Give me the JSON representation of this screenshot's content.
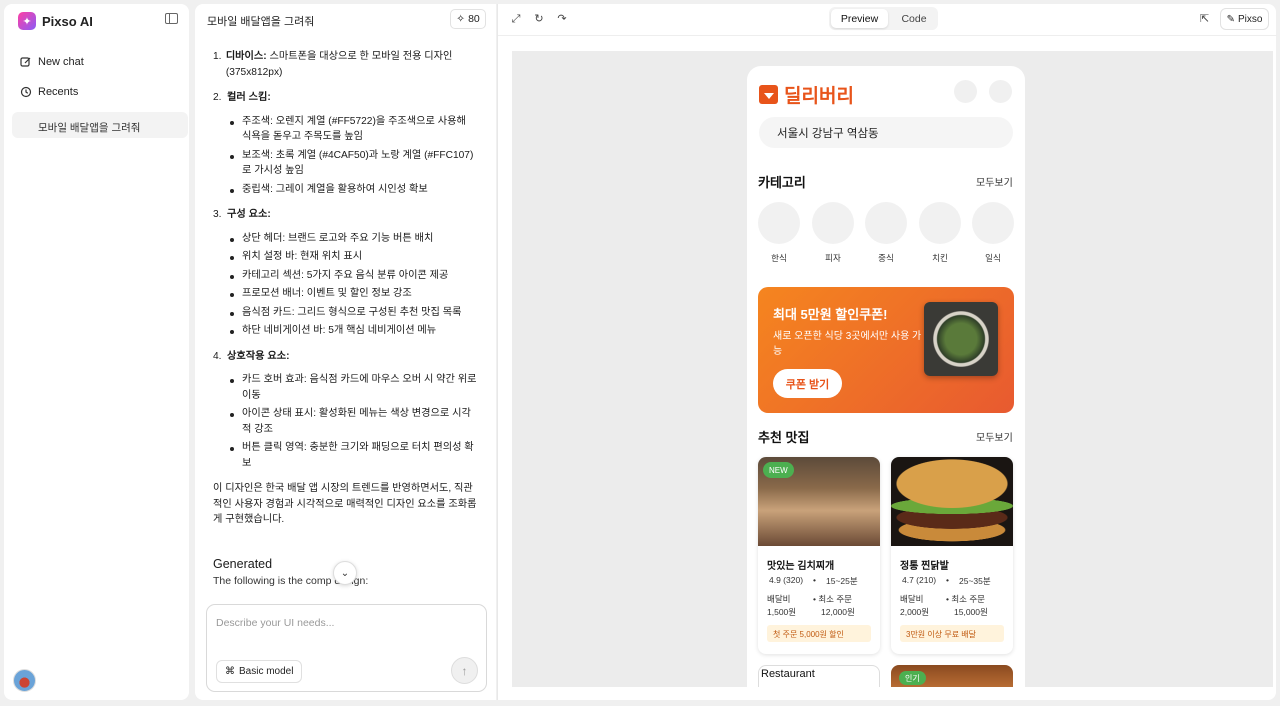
{
  "app": {
    "name": "Pixso AI"
  },
  "sidebar": {
    "new_chat": "New chat",
    "recents": "Recents",
    "recent_items": [
      "모바일 배달앱을 그려줘"
    ]
  },
  "chat": {
    "title": "모바일 배달앱을 그려줘",
    "credits": "80",
    "sections": [
      {
        "num": "1.",
        "title": "디바이스:",
        "text": " 스마트폰을 대상으로 한 모바일 전용 디자인 (375x812px)",
        "bullets": []
      },
      {
        "num": "2.",
        "title": "컬러 스킴:",
        "text": "",
        "bullets": [
          "주조색: 오렌지 계열 (#FF5722)을 주조색으로 사용해 식욕을 돋우고 주목도를 높임",
          "보조색: 초록 계열 (#4CAF50)과 노랑 계열 (#FFC107)로 가시성 높임",
          "중립색: 그레이 계열을 활용하여 시인성 확보"
        ]
      },
      {
        "num": "3.",
        "title": "구성 요소:",
        "text": "",
        "bullets": [
          "상단 헤더: 브랜드 로고와 주요 기능 버튼 배치",
          "위치 설정 바: 현재 위치 표시",
          "카테고리 섹션: 5가지 주요 음식 분류 아이콘 제공",
          "프로모션 배너: 이벤트 및 할인 정보 강조",
          "음식점 카드: 그리드 형식으로 구성된 추천 맛집 목록",
          "하단 네비게이션 바: 5개 핵심 네비게이션 메뉴"
        ]
      },
      {
        "num": "4.",
        "title": "상호작용 요소:",
        "text": "",
        "bullets": [
          "카드 호버 효과: 음식점 카드에 마우스 오버 시 약간 위로 이동",
          "아이콘 상태 표시: 활성화된 메뉴는 색상 변경으로 시각적 강조",
          "버튼 클릭 영역: 충분한 크기와 패딩으로 터치 편의성 확보"
        ]
      }
    ],
    "summary": "이 디자인은 한국 배달 앱 시장의 트렌드를 반영하면서도, 직관적인 사용자 경험과 시각적으로 매력적인 디자인 요소를 조화롭게 구현했습니다.",
    "generated_heading": "Generated",
    "generated_sub": "The following is the comp    design:",
    "composer_placeholder": "Describe your UI needs...",
    "model_label": "Basic model"
  },
  "preview": {
    "tabs": [
      "Preview",
      "Code"
    ],
    "active_tab": "Preview",
    "pixso_button": "Pixso"
  },
  "phone": {
    "brand": "딜리버리",
    "location": "서울시 강남구 역삼동",
    "category_title": "카테고리",
    "see_all": "모두보기",
    "categories": [
      "한식",
      "피자",
      "중식",
      "치킨",
      "일식"
    ],
    "promo": {
      "title": "최대 5만원 할인쿠폰!",
      "subtitle": "새로 오픈한 식당 3곳에서만 사용 가능",
      "button": "쿠폰 받기"
    },
    "recommended_title": "추천 맛집",
    "restaurants": [
      {
        "badge": "NEW",
        "name": "맛있는 김치찌개",
        "rating": "4.9 (320)",
        "time": "15~25분",
        "fee_label": "배달비",
        "fee": "1,500원",
        "min_label": "최소 주문",
        "min": "12,000원",
        "promo": "첫 주문 5,000원 할인"
      },
      {
        "badge": "",
        "name": "정통 찐닭발",
        "rating": "4.7 (210)",
        "time": "25~35분",
        "fee_label": "배달비",
        "fee": "2,000원",
        "min_label": "최소 주문",
        "min": "15,000원",
        "promo": "3만원 이상 무료 배달"
      }
    ],
    "partial_card_alt": "Restaurant",
    "partial_badge": "인기"
  },
  "colors": {
    "brand": "#e8541a",
    "accent_green": "#4caf50"
  }
}
